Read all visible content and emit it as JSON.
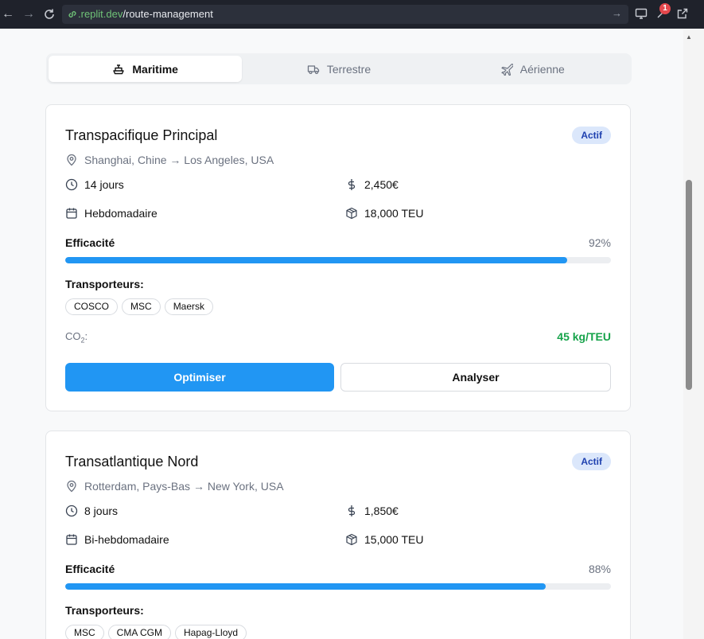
{
  "browser": {
    "url_domain": ".replit.dev",
    "url_path": "/route-management",
    "notification_count": "1"
  },
  "tabs": [
    {
      "label": "Maritime",
      "icon": "ship-icon",
      "active": true
    },
    {
      "label": "Terrestre",
      "icon": "truck-icon",
      "active": false
    },
    {
      "label": "Aérienne",
      "icon": "plane-icon",
      "active": false
    }
  ],
  "routes": [
    {
      "name": "Transpacifique Principal",
      "status": "Actif",
      "route": "Shanghai, Chine → Los Angeles, USA",
      "duration": "14 jours",
      "price": "2,450€",
      "frequency": "Hebdomadaire",
      "capacity": "18,000 TEU",
      "efficiency_label": "Efficacité",
      "efficiency_text": "92%",
      "efficiency": 92,
      "carriers_label": "Transporteurs:",
      "carriers": [
        "COSCO",
        "MSC",
        "Maersk"
      ],
      "co2_label": "CO",
      "co2_sub": "2",
      "co2_suffix": ":",
      "co2_value": "45 kg/TEU",
      "optimize_label": "Optimiser",
      "analyze_label": "Analyser"
    },
    {
      "name": "Transatlantique Nord",
      "status": "Actif",
      "route": "Rotterdam, Pays-Bas → New York, USA",
      "duration": "8 jours",
      "price": "1,850€",
      "frequency": "Bi-hebdomadaire",
      "capacity": "15,000 TEU",
      "efficiency_label": "Efficacité",
      "efficiency_text": "88%",
      "efficiency": 88,
      "carriers_label": "Transporteurs:",
      "carriers": [
        "MSC",
        "CMA CGM",
        "Hapag-Lloyd"
      ]
    }
  ],
  "colors": {
    "primary": "#2196f3",
    "status_bg": "#dbe7fb",
    "co2_green": "#16a34a"
  }
}
